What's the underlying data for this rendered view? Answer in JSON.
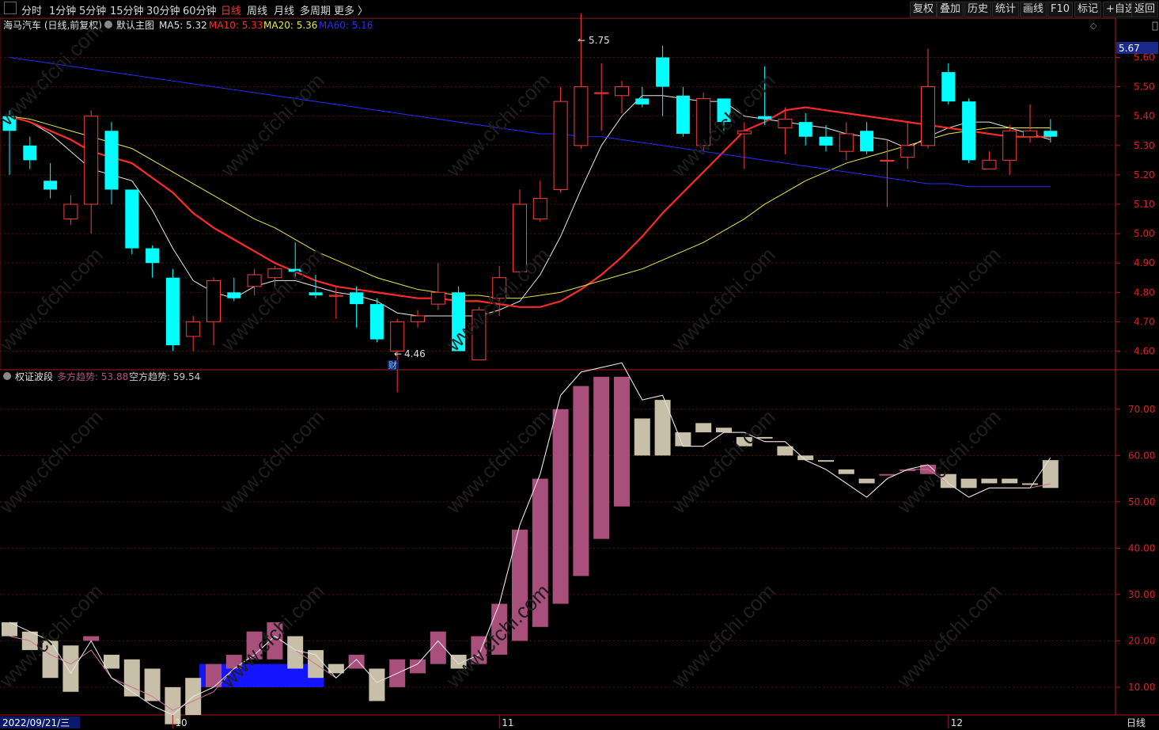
{
  "toolbar": {
    "periods": [
      "分时",
      "1分钟",
      "5分钟",
      "15分钟",
      "30分钟",
      "60分钟",
      "日线",
      "周线",
      "月线",
      "多周期",
      "更多 〉"
    ],
    "active_period": "日线",
    "right_buttons": [
      "复权",
      "叠加",
      "历史",
      "统计",
      "画线",
      "F10",
      "标记",
      "+自选",
      "返回"
    ]
  },
  "main_panel": {
    "stock_name": "海马汽车 (日线,前复权)",
    "template_name": "默认主图",
    "ma": [
      {
        "name": "MA5",
        "label": "MA5: 5.32",
        "color": "#e8e8e8"
      },
      {
        "name": "MA10",
        "label": "MA10: 5.33",
        "color": "#ff2a2a"
      },
      {
        "name": "MA20",
        "label": "MA20: 5.36",
        "color": "#e8e840"
      },
      {
        "name": "MA60",
        "label": "MA60: 5.16",
        "color": "#2a2aff"
      }
    ],
    "current_price": "5.67",
    "y_ticks": [
      "5.60",
      "5.50",
      "5.40",
      "5.30",
      "5.20",
      "5.10",
      "5.00",
      "4.90",
      "4.80",
      "4.70",
      "4.60"
    ],
    "high_marker": "5.75",
    "low_marker": "4.46",
    "event_marker": "财"
  },
  "sub_panel": {
    "indicator_name": "权证波段",
    "long_label": "多方趋势: 53.88",
    "short_label": "空方趋势: 59.54",
    "long_color": "#b05080",
    "y_ticks": [
      "70.00",
      "60.00",
      "50.00",
      "40.00",
      "30.00",
      "20.00",
      "10.00"
    ]
  },
  "x_axis": {
    "start_date": "2022/09/21/三",
    "month_labels": [
      "10",
      "11",
      "12"
    ],
    "period_label": "日线"
  },
  "colors": {
    "up": "#ff3a3a",
    "down": "#00ffff",
    "long_bar": "#a84f7c",
    "short_bar": "#c7bfa8",
    "signal": "#1414ff",
    "grid": "#5a1010"
  },
  "chart_data": [
    {
      "type": "candlestick",
      "title": "海马汽车 (日线,前复权)",
      "ylim": [
        4.55,
        5.72
      ],
      "candles": [
        [
          5.4,
          5.35,
          5.42,
          5.2
        ],
        [
          5.3,
          5.25,
          5.33,
          5.22
        ],
        [
          5.18,
          5.15,
          5.24,
          5.12
        ],
        [
          5.05,
          5.1,
          5.13,
          5.03
        ],
        [
          5.1,
          5.4,
          5.42,
          5.0
        ],
        [
          5.35,
          5.15,
          5.38,
          5.1
        ],
        [
          5.15,
          4.95,
          5.15,
          4.93
        ],
        [
          4.95,
          4.9,
          4.96,
          4.85
        ],
        [
          4.85,
          4.62,
          4.88,
          4.6
        ],
        [
          4.65,
          4.7,
          4.72,
          4.6
        ],
        [
          4.7,
          4.84,
          4.85,
          4.62
        ],
        [
          4.8,
          4.78,
          4.85,
          4.77
        ],
        [
          4.82,
          4.86,
          4.88,
          4.79
        ],
        [
          4.85,
          4.88,
          4.89,
          4.82
        ],
        [
          4.88,
          4.87,
          4.97,
          4.85
        ],
        [
          4.8,
          4.79,
          4.86,
          4.78
        ],
        [
          4.79,
          4.79,
          4.82,
          4.71
        ],
        [
          4.8,
          4.76,
          4.82,
          4.68
        ],
        [
          4.76,
          4.64,
          4.78,
          4.63
        ],
        [
          4.6,
          4.7,
          4.71,
          4.46
        ],
        [
          4.7,
          4.72,
          4.74,
          4.68
        ],
        [
          4.76,
          4.8,
          4.9,
          4.74
        ],
        [
          4.8,
          4.6,
          4.82,
          4.6
        ],
        [
          4.57,
          4.74,
          4.75,
          4.57
        ],
        [
          4.78,
          4.85,
          4.89,
          4.72
        ],
        [
          4.87,
          5.1,
          5.15,
          4.87
        ],
        [
          5.05,
          5.12,
          5.18,
          5.04
        ],
        [
          5.15,
          5.45,
          5.5,
          5.14
        ],
        [
          5.3,
          5.5,
          5.75,
          5.29
        ],
        [
          5.48,
          5.48,
          5.58,
          5.35
        ],
        [
          5.47,
          5.5,
          5.52,
          5.41
        ],
        [
          5.46,
          5.44,
          5.5,
          5.43
        ],
        [
          5.6,
          5.5,
          5.64,
          5.4
        ],
        [
          5.47,
          5.34,
          5.5,
          5.33
        ],
        [
          5.3,
          5.46,
          5.48,
          5.28
        ],
        [
          5.46,
          5.38,
          5.46,
          5.35
        ],
        [
          5.34,
          5.35,
          5.38,
          5.22
        ],
        [
          5.4,
          5.39,
          5.57,
          5.37
        ],
        [
          5.36,
          5.39,
          5.43,
          5.27
        ],
        [
          5.38,
          5.33,
          5.41,
          5.3
        ],
        [
          5.33,
          5.3,
          5.37,
          5.28
        ],
        [
          5.28,
          5.34,
          5.38,
          5.25
        ],
        [
          5.35,
          5.28,
          5.38,
          5.27
        ],
        [
          5.25,
          5.25,
          5.32,
          5.09
        ],
        [
          5.26,
          5.3,
          5.38,
          5.22
        ],
        [
          5.3,
          5.5,
          5.63,
          5.29
        ],
        [
          5.55,
          5.45,
          5.58,
          5.44
        ],
        [
          5.45,
          5.25,
          5.46,
          5.24
        ],
        [
          5.22,
          5.25,
          5.28,
          5.22
        ],
        [
          5.25,
          5.35,
          5.37,
          5.2
        ],
        [
          5.33,
          5.35,
          5.44,
          5.31
        ],
        [
          5.35,
          5.33,
          5.39,
          5.31
        ]
      ],
      "series": [
        {
          "name": "MA5",
          "values": [
            5.4,
            5.38,
            5.34,
            5.28,
            5.22,
            5.2,
            5.18,
            5.08,
            4.95,
            4.84,
            4.8,
            4.78,
            4.82,
            4.84,
            4.84,
            4.82,
            4.8,
            4.79,
            4.77,
            4.73,
            4.72,
            4.72,
            4.72,
            4.72,
            4.74,
            4.77,
            4.86,
            4.99,
            5.15,
            5.3,
            5.4,
            5.47,
            5.47,
            5.46,
            5.45,
            5.45,
            5.4,
            5.39,
            5.38,
            5.37,
            5.36,
            5.34,
            5.33,
            5.32,
            5.29,
            5.33,
            5.36,
            5.38,
            5.38,
            5.36,
            5.34,
            5.32
          ]
        },
        {
          "name": "MA10",
          "values": [
            5.4,
            5.38,
            5.35,
            5.32,
            5.28,
            5.26,
            5.24,
            5.19,
            5.14,
            5.07,
            5.02,
            4.98,
            4.94,
            4.9,
            4.87,
            4.84,
            4.82,
            4.81,
            4.8,
            4.79,
            4.78,
            4.78,
            4.77,
            4.77,
            4.76,
            4.75,
            4.75,
            4.77,
            4.81,
            4.86,
            4.92,
            4.99,
            5.07,
            5.14,
            5.21,
            5.28,
            5.35,
            5.38,
            5.42,
            5.43,
            5.42,
            5.41,
            5.4,
            5.39,
            5.38,
            5.37,
            5.36,
            5.35,
            5.34,
            5.33,
            5.33,
            5.33
          ]
        },
        {
          "name": "MA20",
          "values": [
            5.4,
            5.39,
            5.37,
            5.35,
            5.33,
            5.31,
            5.29,
            5.25,
            5.21,
            5.17,
            5.13,
            5.09,
            5.05,
            5.02,
            4.98,
            4.94,
            4.91,
            4.88,
            4.85,
            4.83,
            4.81,
            4.8,
            4.79,
            4.79,
            4.78,
            4.78,
            4.79,
            4.8,
            4.82,
            4.84,
            4.86,
            4.88,
            4.91,
            4.94,
            4.97,
            5.01,
            5.05,
            5.1,
            5.14,
            5.18,
            5.21,
            5.24,
            5.26,
            5.28,
            5.3,
            5.32,
            5.34,
            5.35,
            5.36,
            5.36,
            5.36,
            5.36
          ]
        },
        {
          "name": "MA60",
          "values": [
            5.6,
            5.59,
            5.58,
            5.57,
            5.56,
            5.55,
            5.54,
            5.53,
            5.52,
            5.51,
            5.5,
            5.49,
            5.48,
            5.47,
            5.46,
            5.45,
            5.44,
            5.43,
            5.42,
            5.41,
            5.4,
            5.39,
            5.38,
            5.37,
            5.36,
            5.35,
            5.34,
            5.34,
            5.33,
            5.33,
            5.32,
            5.31,
            5.3,
            5.29,
            5.28,
            5.27,
            5.26,
            5.25,
            5.24,
            5.23,
            5.22,
            5.21,
            5.2,
            5.19,
            5.18,
            5.17,
            5.17,
            5.16,
            5.16,
            5.16,
            5.16,
            5.16
          ]
        }
      ]
    },
    {
      "type": "bar",
      "title": "权证波段",
      "ylim": [
        4,
        78
      ],
      "long_trend": [
        21,
        20,
        17,
        15,
        18,
        12,
        10,
        8,
        5,
        7,
        9,
        14,
        17,
        21,
        18,
        15,
        12,
        16,
        11,
        13,
        15,
        20,
        15,
        17,
        28,
        45,
        56,
        73,
        78,
        79,
        80,
        72,
        73,
        62,
        62,
        65,
        65,
        63,
        63,
        59,
        57,
        54,
        51,
        55,
        57,
        57,
        54,
        51,
        53,
        53,
        53,
        53.88
      ],
      "short_trend": [
        24,
        22,
        20,
        13,
        20,
        12,
        9,
        6,
        4,
        8,
        10,
        14,
        17,
        21,
        18,
        17,
        12,
        16,
        11,
        13,
        15,
        20,
        15,
        17,
        28,
        45,
        56,
        73,
        78,
        79,
        80,
        72,
        73,
        62,
        62,
        65,
        65,
        63,
        63,
        59,
        57,
        54,
        51,
        55,
        57,
        58,
        54,
        51,
        53,
        53,
        53,
        59.54
      ],
      "bar_top": [
        24,
        22,
        20,
        19,
        21,
        17,
        16,
        14,
        10,
        12,
        15,
        17,
        22,
        24,
        21,
        18,
        15,
        17,
        14,
        16,
        16,
        22,
        17,
        21,
        28,
        44,
        55,
        70,
        75,
        77,
        77,
        68,
        72,
        62,
        65,
        65,
        64,
        64,
        62,
        60,
        59,
        56,
        54,
        56,
        57,
        58,
        56,
        53,
        55,
        55,
        54,
        59
      ],
      "bar_bottom": [
        21,
        18,
        12,
        9,
        20,
        14,
        8,
        7,
        2,
        4,
        10,
        14,
        16,
        16,
        14,
        12,
        13,
        14,
        7,
        10,
        13,
        15,
        14,
        15,
        17,
        20,
        23,
        28,
        34,
        42,
        49,
        60,
        60,
        65,
        67,
        66,
        62,
        64,
        60,
        59,
        59,
        57,
        55,
        56,
        57,
        56,
        53,
        55,
        54,
        54,
        54,
        53
      ]
    }
  ]
}
